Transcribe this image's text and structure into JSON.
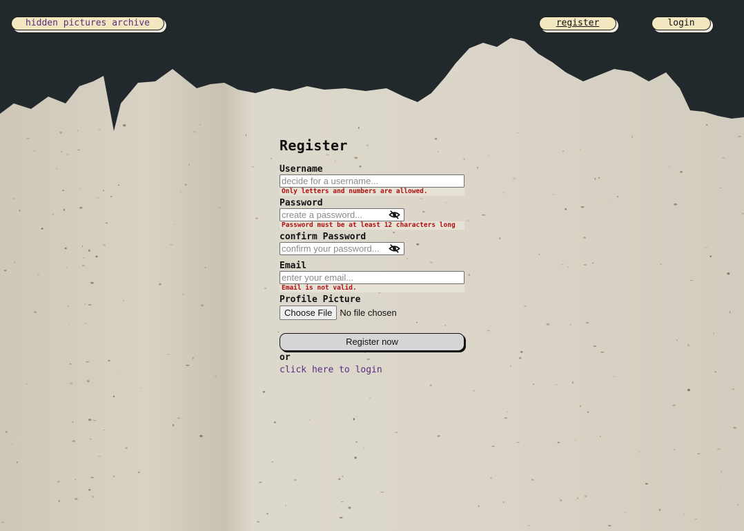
{
  "nav": {
    "home_label": "hidden pictures archive",
    "register_label": "register",
    "login_label": "login"
  },
  "form": {
    "title": "Register",
    "username": {
      "label": "Username",
      "placeholder": "decide for a username...",
      "error": "Only letters and numbers are allowed."
    },
    "password": {
      "label": "Password",
      "placeholder": "create a password...",
      "error": "Password must be at least 12 characters long",
      "toggle_icon": "eye-slash-icon"
    },
    "confirm_password": {
      "label": "confirm Password",
      "placeholder": "confirm your password...",
      "toggle_icon": "eye-slash-icon"
    },
    "email": {
      "label": "Email",
      "placeholder": "enter your email...",
      "error": "Email is not valid."
    },
    "profile_picture": {
      "label": "Profile Picture",
      "button_label": "Choose File",
      "status": "No file chosen"
    },
    "submit_label": "Register now",
    "or_text": "or",
    "login_link": "click here to login"
  },
  "colors": {
    "backdrop": "#22292c",
    "paper": "#d9d3c6",
    "pill_fill": "#f3e7bf",
    "link": "#5b2c83",
    "error": "#b01010"
  }
}
